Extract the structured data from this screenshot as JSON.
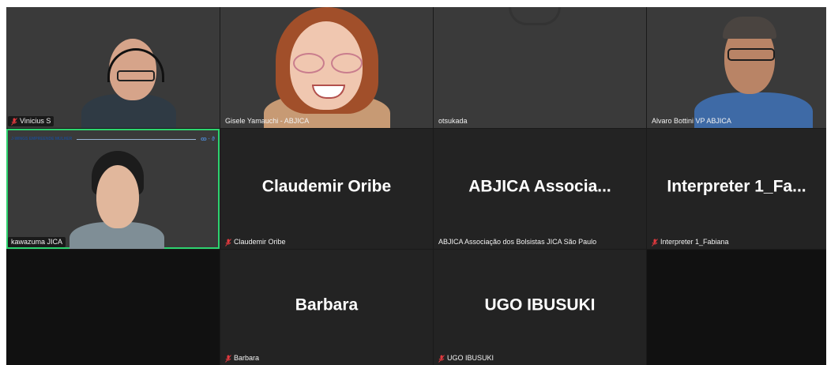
{
  "participants": {
    "vinicius": {
      "name": "Vinicius S"
    },
    "gisele": {
      "name": "Gisele Yamauchi - ABJICA"
    },
    "otsukada": {
      "name": "otsukada"
    },
    "alvaro": {
      "name": "Alvaro Bottini VP ABJICA"
    },
    "kawazuma": {
      "name": "kawazuma JICA",
      "banner": "J-WINGS EMPREENDE MULHER",
      "banner_logo": "ꝏ · ϑ"
    },
    "claudemir": {
      "display": "Claudemir Oribe",
      "name": "Claudemir Oribe"
    },
    "abjica": {
      "display": "ABJICA  Associa...",
      "name": "ABJICA Associação dos Bolsistas JICA São Paulo"
    },
    "interpreter": {
      "display": "Interpreter  1_Fa...",
      "name": "Interpreter 1_Fabiana"
    },
    "barbara": {
      "display": "Barbara",
      "name": "Barbara"
    },
    "ugo": {
      "display": "UGO IBUSUKI",
      "name": "UGO IBUSUKI"
    }
  },
  "colors": {
    "muted_mic": "#e0393e",
    "active_speaker": "#2dd36f",
    "tile_bg": "#232323"
  }
}
